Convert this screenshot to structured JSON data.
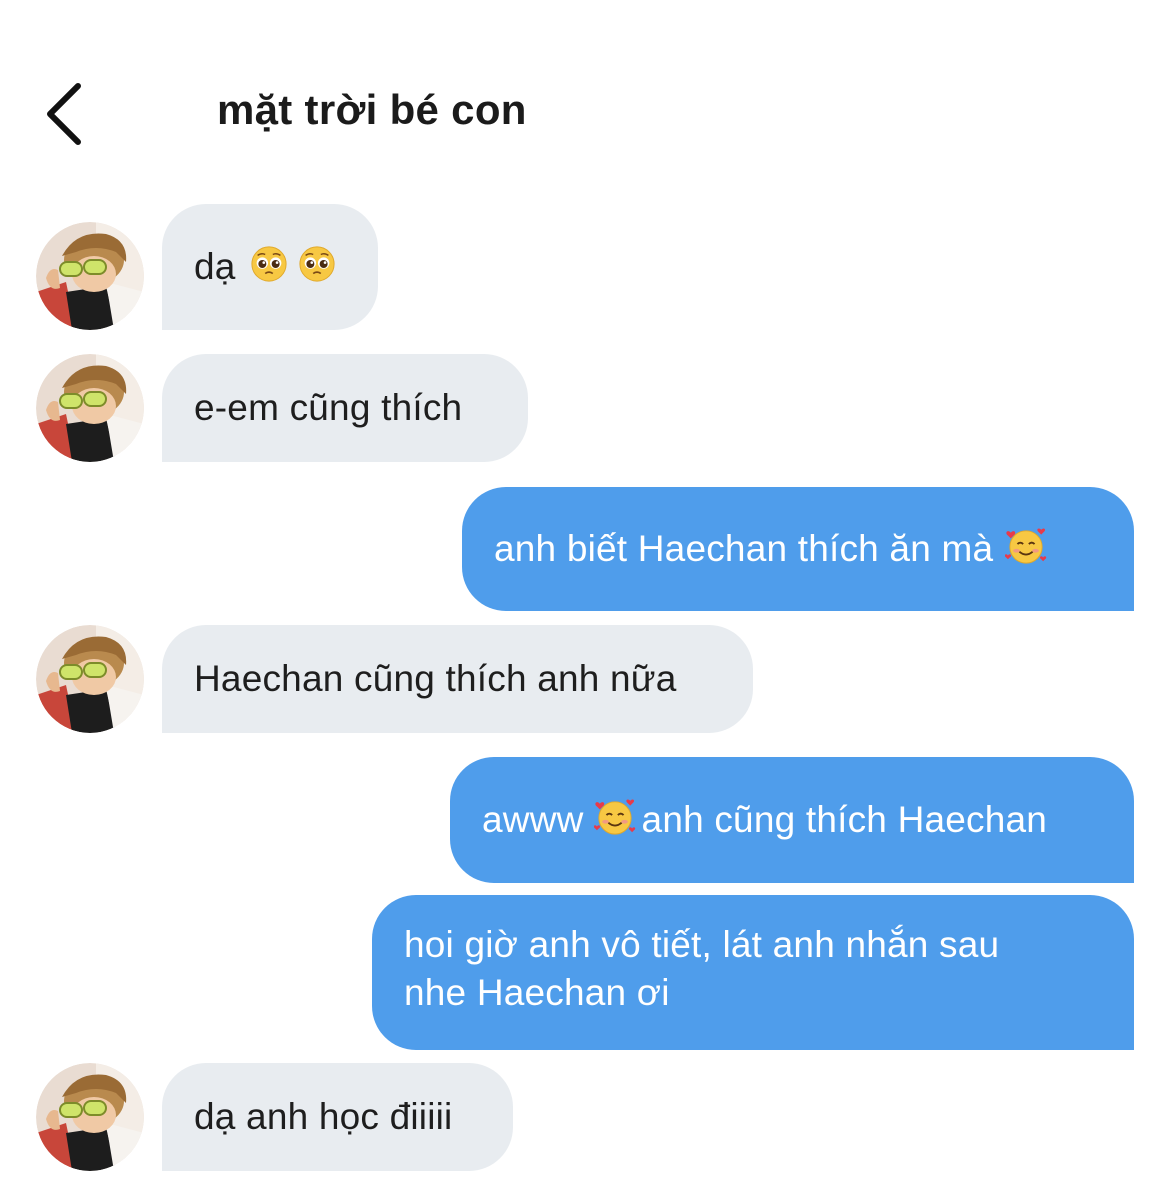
{
  "header": {
    "back_icon": "chevron-left-icon",
    "title": "mặt trời bé con"
  },
  "colors": {
    "incoming_bubble": "#e8ecf0",
    "outgoing_bubble": "#4f9deb",
    "incoming_text": "#1e1e1e",
    "outgoing_text": "#ffffff"
  },
  "messages": [
    {
      "direction": "incoming",
      "text": "dạ",
      "emojis": [
        "pleading-face-emoji",
        "pleading-face-emoji"
      ]
    },
    {
      "direction": "incoming",
      "text": "e-em cũng thích"
    },
    {
      "direction": "outgoing",
      "text": "anh biết Haechan thích ăn mà",
      "emojis": [
        "smiling-face-with-hearts-emoji"
      ]
    },
    {
      "direction": "incoming",
      "text": "Haechan cũng thích anh nữa"
    },
    {
      "direction": "outgoing",
      "text_before": "awww",
      "emojis": [
        "smiling-face-with-hearts-emoji"
      ],
      "text_after": "anh cũng thích Haechan"
    },
    {
      "direction": "outgoing",
      "lines": [
        "hoi giờ anh vô tiết, lát anh nhắn sau",
        "nhe Haechan ơi"
      ]
    },
    {
      "direction": "incoming",
      "text": "dạ anh học điiiii"
    }
  ]
}
